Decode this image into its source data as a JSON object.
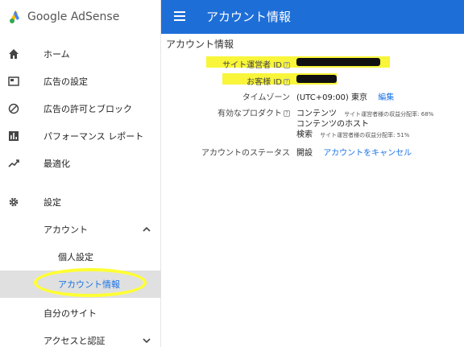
{
  "sidebar": {
    "brand": "Google AdSense",
    "items": [
      {
        "label": "ホーム",
        "icon": "home-icon"
      },
      {
        "label": "広告の設定",
        "icon": "ad-settings-icon"
      },
      {
        "label": "広告の許可とブロック",
        "icon": "block-icon"
      },
      {
        "label": "パフォーマンス レポート",
        "icon": "reports-icon"
      },
      {
        "label": "最適化",
        "icon": "trending-icon"
      },
      {
        "label": "設定",
        "icon": "gear-icon"
      },
      {
        "label": "アカウント"
      },
      {
        "label": "個人設定"
      },
      {
        "label": "アカウント情報"
      },
      {
        "label": "自分のサイト"
      },
      {
        "label": "アクセスと認証"
      }
    ]
  },
  "header": {
    "title": "アカウント情報"
  },
  "main": {
    "page_title": "アカウント情報",
    "site_owner_label": "サイト運営者 ID",
    "customer_id_label": "お客様 ID",
    "timezone_label": "タイムゾーン",
    "timezone_value": "(UTC+09:00) 東京",
    "edit_link": "編集",
    "products_label": "有効なプロダクト",
    "product_1": "コンテンツ",
    "product_1_share": "サイト運営者様の収益分配率: 68%",
    "product_2": "コンテンツのホスト",
    "product_3": "検索",
    "product_3_share": "サイト運営者様の収益分配率: 51%",
    "status_label": "アカウントのステータス",
    "status_value": "開設",
    "cancel_link": "アカウントをキャンセル",
    "help_mark": "?"
  },
  "colors": {
    "header": "#1e6ed8",
    "highlight": "#f8f53a",
    "link": "#1a73e8"
  }
}
